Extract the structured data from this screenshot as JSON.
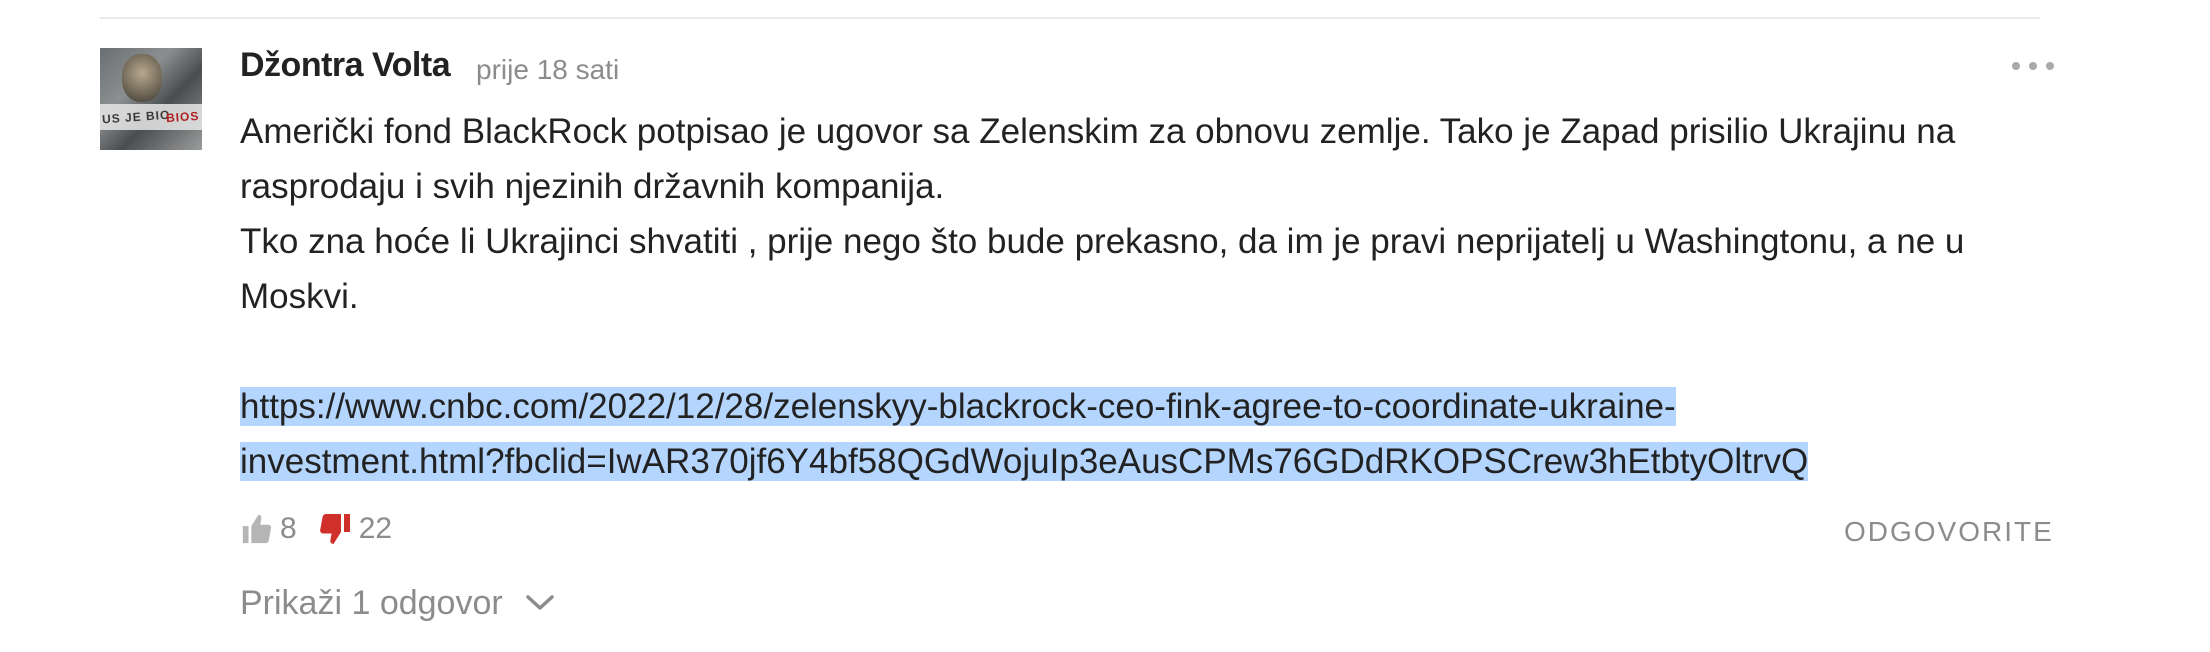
{
  "comment": {
    "author": "Džontra Volta",
    "timestamp": "prije 18 sati",
    "paragraph_1": "Američki fond BlackRock potpisao je ugovor sa Zelenskim za obnovu zemlje. Tako je Zapad prisilio Ukrajinu na rasprodaju i svih njezinih državnih kompanija.",
    "paragraph_2": "Tko zna hoće li Ukrajinci shvatiti , prije nego što bude prekasno, da im je pravi neprijatelj u Washingtonu, a ne u Moskvi.",
    "link": "https://www.cnbc.com/2022/12/28/zelenskyy-blackrock-ceo-fink-agree-to-coordinate-ukraine-investment.html?fbclid=IwAR370jf6Y4bf58QGdWojuIp3eAusCPMs76GDdRKOPSCrew3hEtbtyOltrvQ",
    "link_line_1": "https://www.cnbc.com/2022/12/28/zelenskyy-blackrock-ceo-fink-agree-to-coordinate-ukraine-",
    "link_line_2": "investment.html?fbclid=IwAR370jf6Y4bf58QGdWojuIp3eAusCPMs76GDdRKOPSCrew3hEtbtyOltrvQ",
    "avatar_text_left": "US JE BIO",
    "avatar_text_right": "BIOS"
  },
  "actions": {
    "upvote_count": "8",
    "downvote_count": "22",
    "reply_label": "ODGOVORITE",
    "show_replies_label": "Prikaži 1 odgovor"
  },
  "icons": {
    "upvote": "thumbs-up-icon",
    "downvote": "thumbs-down-icon",
    "more": "more-horizontal-icon",
    "expand": "chevron-down-icon"
  },
  "colors": {
    "text": "#222222",
    "muted": "#8c8c8c",
    "link_highlight": "#b4d5fe",
    "downvote_active": "#d0302a",
    "upvote_inactive": "#b5b5b5"
  }
}
